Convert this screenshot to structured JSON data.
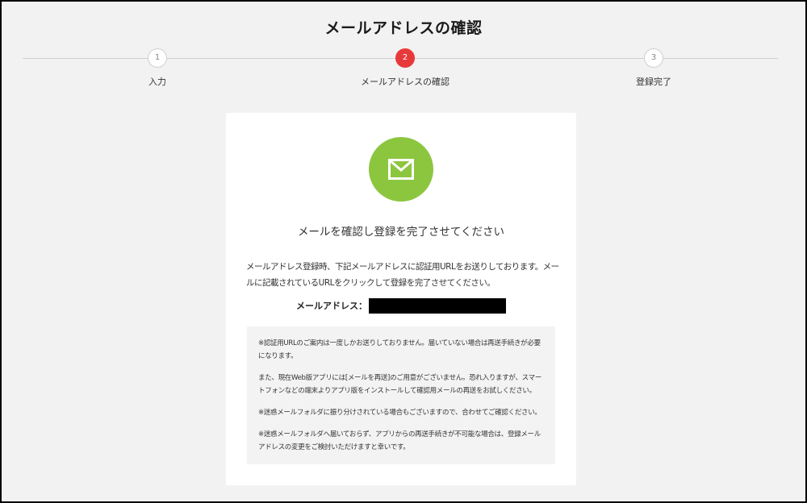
{
  "page": {
    "title": "メールアドレスの確認"
  },
  "stepper": {
    "steps": [
      {
        "number": "1",
        "label": "入力",
        "active": false
      },
      {
        "number": "2",
        "label": "メールアドレスの確認",
        "active": true
      },
      {
        "number": "3",
        "label": "登録完了",
        "active": false
      }
    ]
  },
  "card": {
    "icon": "mail-icon",
    "heading": "メールを確認し登録を完了させてください",
    "description": "メールアドレス登録時、下記メールアドレスに認証用URLをお送りしております。メールに記載されているURLをクリックして登録を完了させてください。",
    "email_label": "メールアドレス：",
    "notices": [
      "※認証用URLのご案内は一度しかお送りしておりません。届いていない場合は再送手続きが必要になります。",
      "また、現在Web版アプリには[メールを再送]のご用意がございません。恐れ入りますが、スマートフォンなどの端末よりアプリ版をインストールして確認用メールの再送をお試しください。",
      "※迷惑メールフォルダに振り分けされている場合もございますので、合わせてご確認ください。",
      "※迷惑メールフォルダへ届いておらず、アプリからの再送手続きが不可能な場合は、登録メールアドレスの変更をご検討いただけますと幸いです。"
    ]
  },
  "colors": {
    "accent_red": "#e8393a",
    "icon_green": "#8cc63f",
    "background": "#f2f2f2"
  }
}
